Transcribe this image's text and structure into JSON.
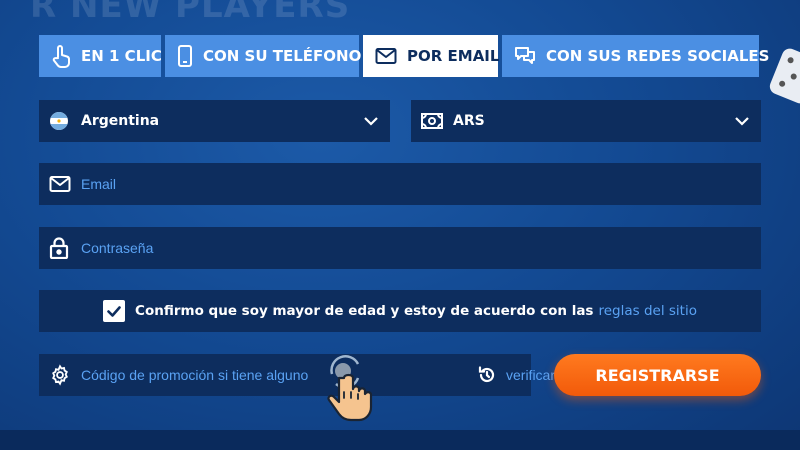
{
  "background_text": "R NEW PLAYERS",
  "tabs": [
    {
      "label": "EN 1 CLIC",
      "icon": "tap-icon",
      "active": false
    },
    {
      "label": "CON SU TELÉFONO",
      "icon": "phone-icon",
      "active": false
    },
    {
      "label": "POR EMAIL",
      "icon": "envelope-icon",
      "active": true
    },
    {
      "label": "CON SUS REDES SOCIALES",
      "icon": "chat-icon",
      "active": false
    }
  ],
  "country": {
    "value": "Argentina",
    "icon": "argentina-flag-icon"
  },
  "currency": {
    "value": "ARS",
    "icon": "banknote-icon"
  },
  "email": {
    "placeholder": "Email"
  },
  "password": {
    "placeholder": "Contraseña"
  },
  "terms": {
    "checked": true,
    "text": "Confirmo que soy mayor de edad y estoy de acuerdo con las",
    "link": "reglas del sitio"
  },
  "promo": {
    "placeholder": "Código de promoción si tiene alguno",
    "verify_label": "verificar"
  },
  "register_label": "REGISTRARSE",
  "colors": {
    "tab_bg": "#4b8fe3",
    "field_bg": "#0d2d5e",
    "link": "#5aa2f3",
    "accent": "#f25a0a"
  }
}
